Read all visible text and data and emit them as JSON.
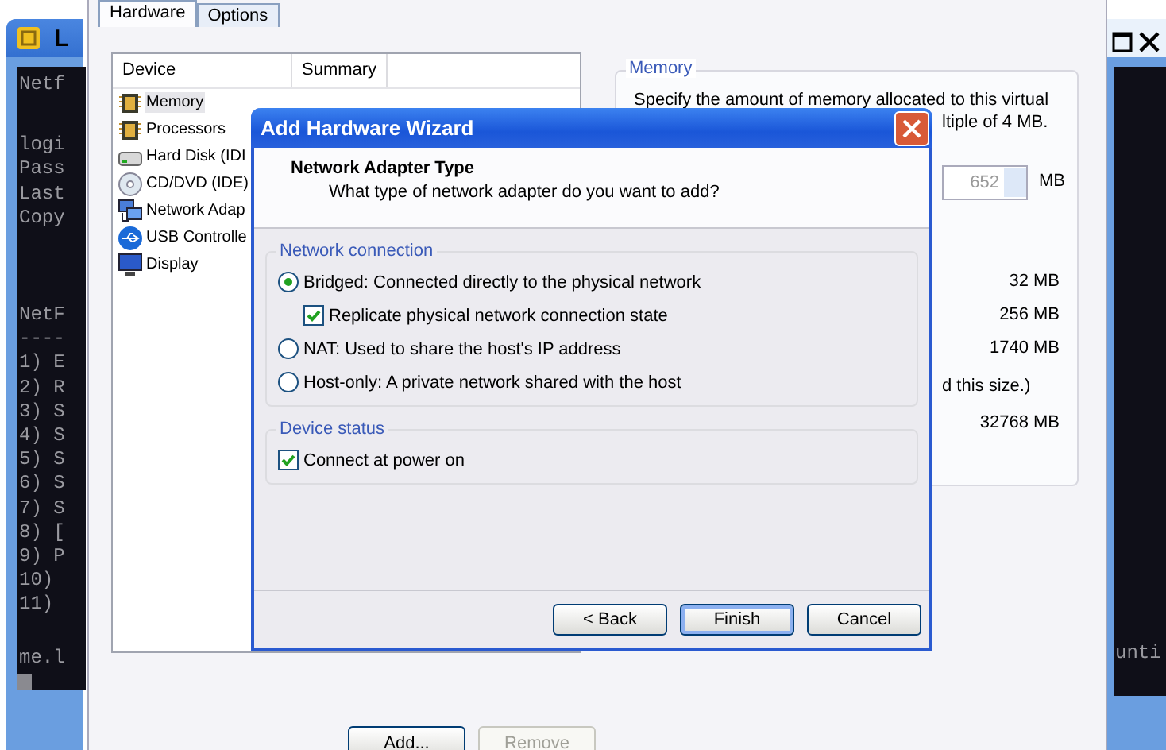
{
  "terminal_left": {
    "title": "L",
    "blocks": [
      [
        "Netf"
      ],
      [
        "logi",
        "Pass",
        "Last",
        "Copy"
      ],
      [
        "NetF",
        "----",
        "1) E",
        "2) R",
        "3) S",
        "4) S",
        "5) S",
        "6) S",
        "7) S",
        "8) [",
        "9) P",
        "10)",
        "11)"
      ],
      [
        "me.l"
      ]
    ]
  },
  "terminal_right": {
    "lines": [
      "unti"
    ]
  },
  "settings": {
    "tabs": [
      {
        "label": "Hardware",
        "selected": true
      },
      {
        "label": "Options",
        "selected": false
      }
    ],
    "device_list": {
      "columns": [
        "Device",
        "Summary"
      ],
      "rows": [
        {
          "kind": "memory",
          "device": "Memory",
          "selected": true
        },
        {
          "kind": "processor",
          "device": "Processors",
          "selected": false
        },
        {
          "kind": "disk",
          "device": "Hard Disk (IDI",
          "selected": false
        },
        {
          "kind": "cd",
          "device": "CD/DVD (IDE)",
          "selected": false
        },
        {
          "kind": "network",
          "device": "Network Adap",
          "selected": false
        },
        {
          "kind": "usb",
          "device": "USB Controlle",
          "selected": false
        },
        {
          "kind": "display",
          "device": "Display",
          "selected": false
        }
      ]
    },
    "memory": {
      "legend": "Memory",
      "description": "Specify the amount of memory allocated to this virtual",
      "description_tail": "ltiple of 4 MB.",
      "value": "652",
      "unit": "MB",
      "readings": [
        "32 MB",
        "256 MB",
        "1740 MB"
      ],
      "note_tail": "d this size.)",
      "maximum": "32768 MB"
    },
    "buttons": [
      {
        "label": "Add...",
        "disabled": false
      },
      {
        "label": "Remove",
        "disabled": true
      }
    ]
  },
  "wizard": {
    "title": "Add Hardware Wizard",
    "heading": "Network Adapter Type",
    "subheading": "What type of network adapter do you want to add?",
    "groups": [
      {
        "legend": "Network connection",
        "options": [
          {
            "kind": "radio",
            "label": "Bridged: Connected directly to the physical network",
            "selected": true,
            "children": [
              {
                "kind": "checkbox",
                "label": "Replicate physical network connection state",
                "checked": true
              }
            ]
          },
          {
            "kind": "radio",
            "label": "NAT: Used to share the host's IP address",
            "selected": false
          },
          {
            "kind": "radio",
            "label": "Host-only: A private network shared with the host",
            "selected": false
          }
        ]
      },
      {
        "legend": "Device status",
        "options": [
          {
            "kind": "checkbox",
            "label": "Connect at power on",
            "checked": true
          }
        ]
      }
    ],
    "buttons": [
      {
        "label": "< Back",
        "default": false
      },
      {
        "label": "Finish",
        "default": true
      },
      {
        "label": "Cancel",
        "default": false
      }
    ]
  }
}
